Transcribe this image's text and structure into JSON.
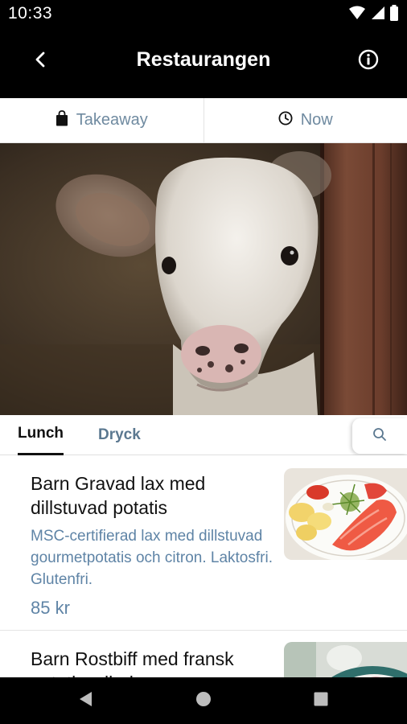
{
  "status_bar": {
    "time": "10:33",
    "icons": [
      "wifi-icon",
      "signal-icon",
      "battery-icon"
    ]
  },
  "app_bar": {
    "title": "Restaurangen",
    "back_icon": "chevron-left-icon",
    "info_icon": "info-icon"
  },
  "order_options": {
    "takeaway": {
      "label": "Takeaway",
      "icon": "bag-icon"
    },
    "time": {
      "label": "Now",
      "icon": "clock-icon"
    }
  },
  "tabs": {
    "items": [
      {
        "label": "Lunch",
        "active": true
      },
      {
        "label": "Dryck",
        "active": false
      }
    ],
    "search_icon": "search-icon"
  },
  "menu": {
    "items": [
      {
        "name": "Barn Gravad lax med dillstuvad potatis",
        "description": "MSC-certifierad lax med dillstuvad gourmetpotatis och citron. Laktosfri. Glutenfri.",
        "price": "85 kr"
      },
      {
        "name": "Barn Rostbiff med fransk potatissallad",
        "description": "",
        "price": ""
      }
    ]
  },
  "colors": {
    "accent_text": "#5f84a6",
    "bar_background": "#000000"
  }
}
